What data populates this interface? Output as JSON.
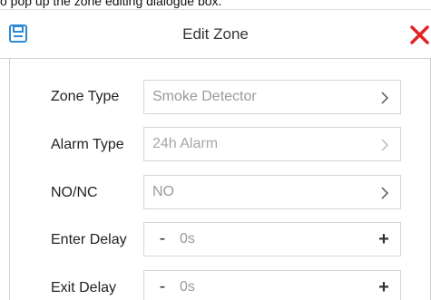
{
  "caption": "o pop up the zone editing dialogue box.",
  "header": {
    "title": "Edit Zone",
    "save_icon": "save-icon",
    "close_icon": "close-icon",
    "accent_color": "#2d88d4",
    "close_color": "#e02424"
  },
  "fields": {
    "zone_type": {
      "label": "Zone Type",
      "value": "Smoke Detector"
    },
    "alarm_type": {
      "label": "Alarm Type",
      "value": "24h Alarm"
    },
    "no_nc": {
      "label": "NO/NC",
      "value": "NO"
    },
    "enter_delay": {
      "label": "Enter Delay",
      "value": "0s",
      "minus": "-",
      "plus": "+"
    },
    "exit_delay": {
      "label": "Exit Delay",
      "value": "0s",
      "minus": "-",
      "plus": "+"
    }
  }
}
